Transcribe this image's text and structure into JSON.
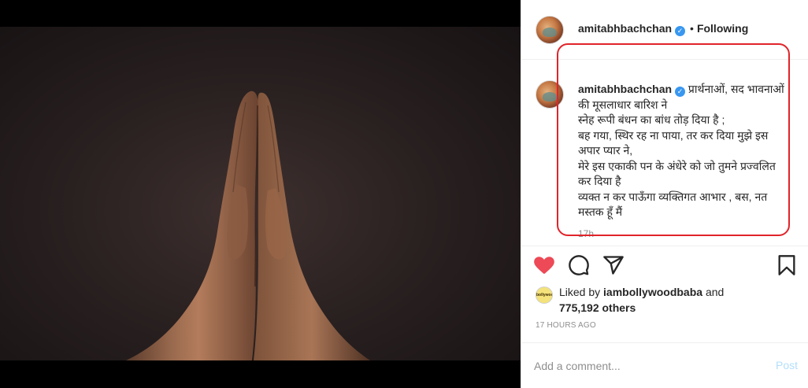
{
  "post": {
    "username": "amitabhbachchan",
    "follow_state": "Following",
    "dot": "•",
    "verified_mark": "✓",
    "caption": {
      "username": "amitabhbachchan",
      "text": "प्रार्थनाओं, सद भावनाओं की मूसलाधार बारिश ने\nस्नेह रूपी बंधन का बांध तोड़ दिया है ;\nबह गया, स्थिर रह ना पाया, तर कर दिया मुझे इस अपार प्यार ने,\nमेरे इस एकाकी पन के अंधेरे को जो तुमने प्रज्वलित कर दिया है\nव्यक्त न कर पाऊँगा व्यक्तिगत आभार , बस, नत मस्तक हूँ मैं",
      "time": "17h"
    },
    "likes": {
      "prefix": "Liked by",
      "liker": "iambollywoodbaba",
      "conjunction": "and",
      "others": "775,192 others",
      "liker_avatar_text": "bollywood"
    },
    "timestamp": "17 HOURS AGO",
    "comment_box": {
      "placeholder": "Add a comment...",
      "post_label": "Post"
    },
    "icons": {
      "like": "heart-icon",
      "comment": "comment-icon",
      "share": "share-icon",
      "save": "bookmark-icon"
    },
    "colors": {
      "like_active": "#ed4956",
      "verified": "#3897f0",
      "highlight_box": "#e0242a",
      "post_disabled": "#b2dffc"
    }
  }
}
